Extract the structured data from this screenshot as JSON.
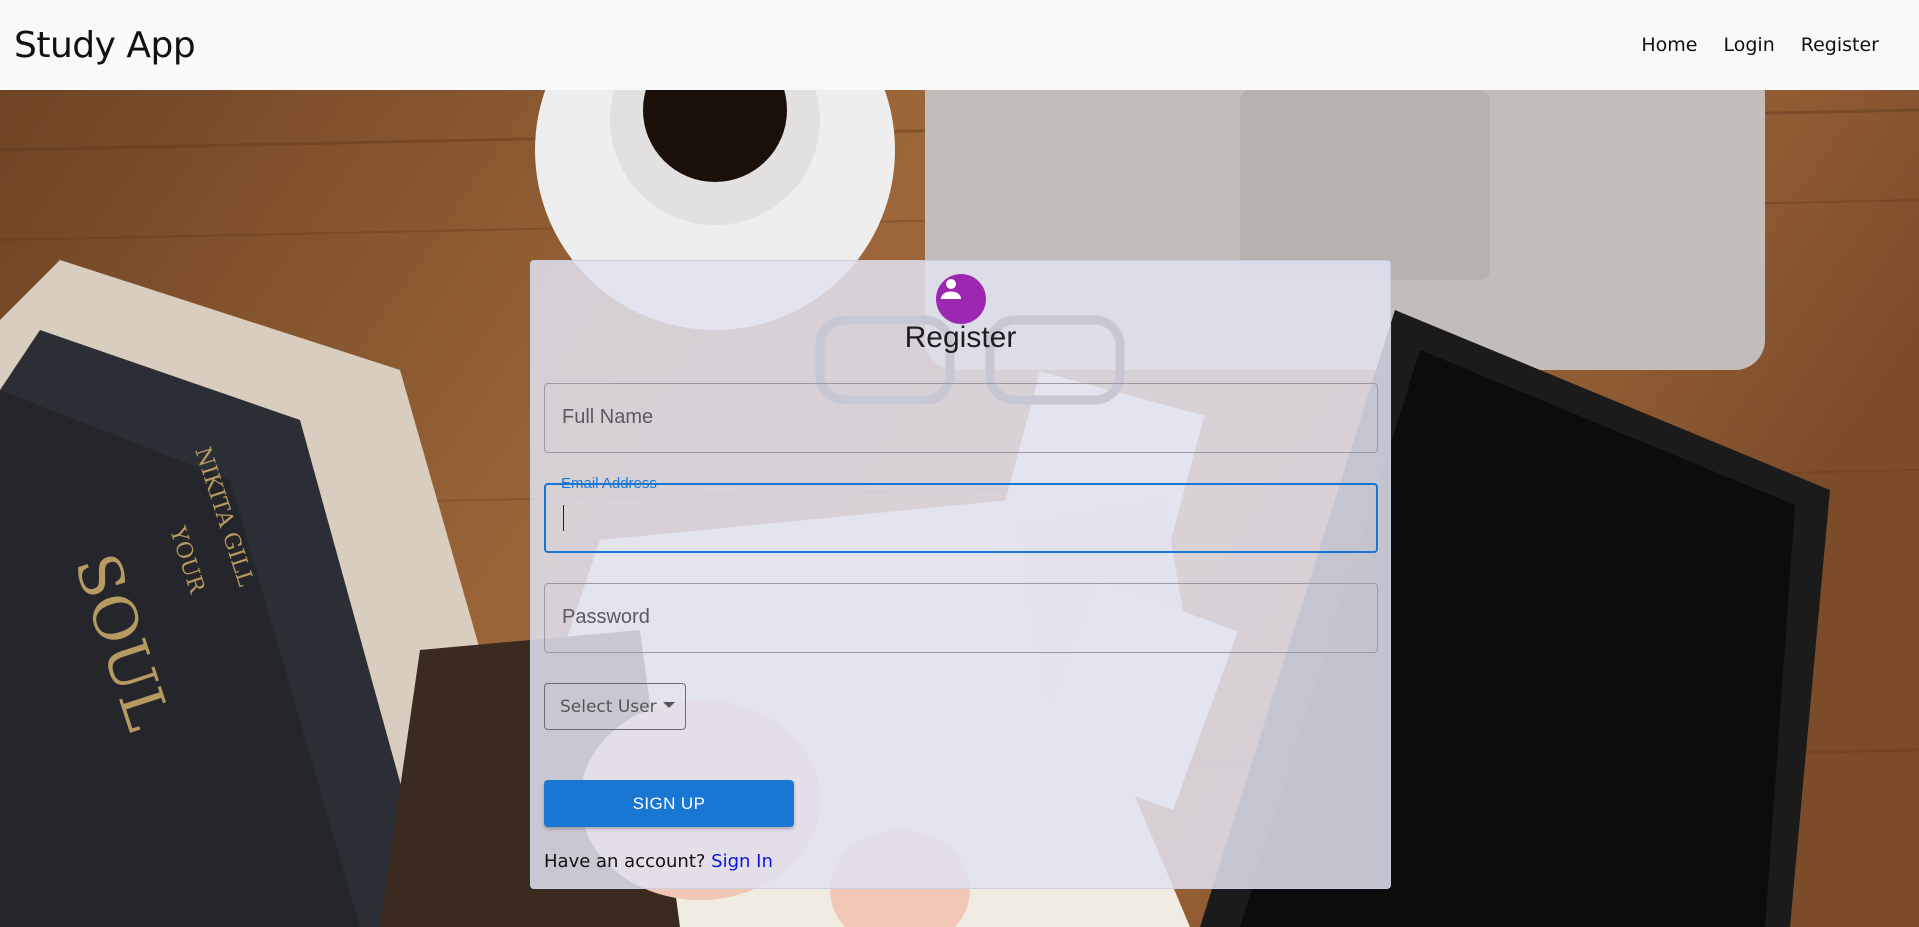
{
  "navbar": {
    "brand": "Study App",
    "links": [
      "Home",
      "Login",
      "Register"
    ]
  },
  "form": {
    "title": "Register",
    "full_name_placeholder": "Full Name",
    "email_label": "Email Address",
    "email_value": "",
    "password_placeholder": "Password",
    "select_user_label": "Select User",
    "signup_label": "SIGN UP",
    "account_prompt": "Have an account?",
    "signin_link": "Sign In"
  },
  "background_image": {
    "book_text_1": "SOUL",
    "book_text_2": "YOUR",
    "book_text_3": "NIKITA GILL"
  },
  "colors": {
    "primary": "#1976d2",
    "avatar": "#9c27b0",
    "link": "#0a14e0",
    "navbar_bg": "#f8f9fb"
  },
  "icons": {
    "avatar": "person-icon",
    "select": "caret-down-icon"
  }
}
